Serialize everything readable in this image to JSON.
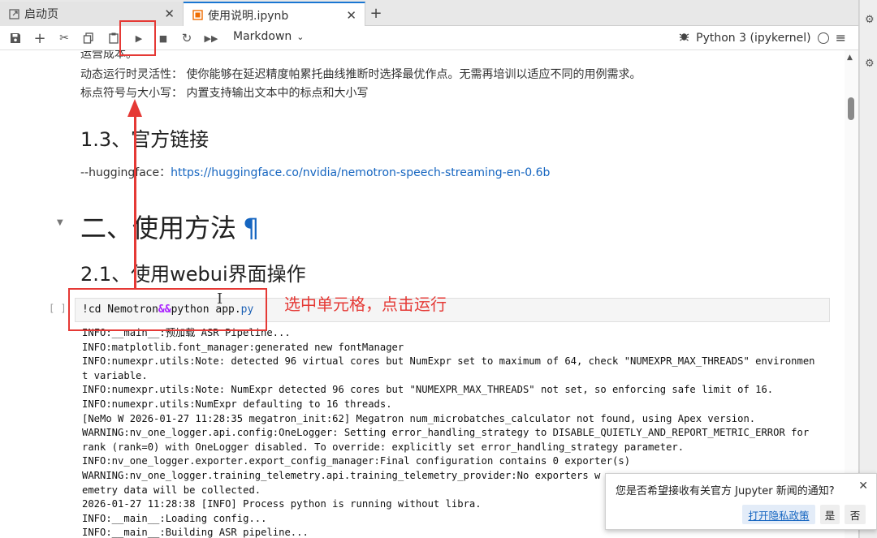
{
  "tabs": [
    {
      "label": "启动页",
      "icon": "launcher-icon"
    },
    {
      "label": "使用说明.ipynb",
      "icon": "notebook-icon"
    }
  ],
  "toolbar": {
    "cell_type": "Markdown",
    "kernel_name": "Python 3 (ipykernel)"
  },
  "content": {
    "lines": [
      "运营成本。",
      "动态运行时灵活性：  使你能够在延迟精度帕累托曲线推断时选择最优作点。无需再培训以适应不同的用例需求。",
      "标点符号与大小写：  内置支持输出文本中的标点和大小写"
    ],
    "h2_link": "1.3、官方链接",
    "link_prefix": "--huggingface：",
    "link_url": "https://huggingface.co/nvidia/nemotron-speech-streaming-en-0.6b",
    "h1": "二、使用方法",
    "anchor": "¶",
    "h2_webui": "2.1、使用webui界面操作"
  },
  "cell": {
    "prompt": "[ ]:",
    "code_part1": "!cd Nemotron",
    "code_op": "&&",
    "code_part2": "python app.",
    "code_attr": "py"
  },
  "output_lines": [
    "INFO:__main__:预加载 ASR Pipeline...",
    "INFO:matplotlib.font_manager:generated new fontManager",
    "INFO:numexpr.utils:Note: detected 96 virtual cores but NumExpr set to maximum of 64, check \"NUMEXPR_MAX_THREADS\" environmen",
    "t variable.",
    "INFO:numexpr.utils:Note: NumExpr detected 96 cores but \"NUMEXPR_MAX_THREADS\" not set, so enforcing safe limit of 16.",
    "INFO:numexpr.utils:NumExpr defaulting to 16 threads.",
    "[NeMo W 2026-01-27 11:28:35 megatron_init:62] Megatron num_microbatches_calculator not found, using Apex version.",
    "WARNING:nv_one_logger.api.config:OneLogger: Setting error_handling_strategy to DISABLE_QUIETLY_AND_REPORT_METRIC_ERROR for",
    "rank (rank=0) with OneLogger disabled. To override: explicitly set error_handling_strategy parameter.",
    "INFO:nv_one_logger.exporter.export_config_manager:Final configuration contains 0 exporter(s)",
    "WARNING:nv_one_logger.training_telemetry.api.training_telemetry_provider:No exporters w",
    "emetry data will be collected.",
    "2026-01-27 11:28:38 [INFO] Process python is running without libra.",
    "INFO:__main__:Loading config...",
    "INFO:__main__:Building ASR pipeline..."
  ],
  "annotation": {
    "text": "选中单元格，点击运行",
    "color": "#e53935"
  },
  "notification": {
    "message": "您是否希望接收有关官方 Jupyter 新闻的通知?",
    "privacy_label": "打开隐私政策",
    "yes_label": "是",
    "no_label": "否"
  },
  "colors": {
    "accent": "#1976d2",
    "link": "#1565c0",
    "operator": "#aa22ff"
  }
}
